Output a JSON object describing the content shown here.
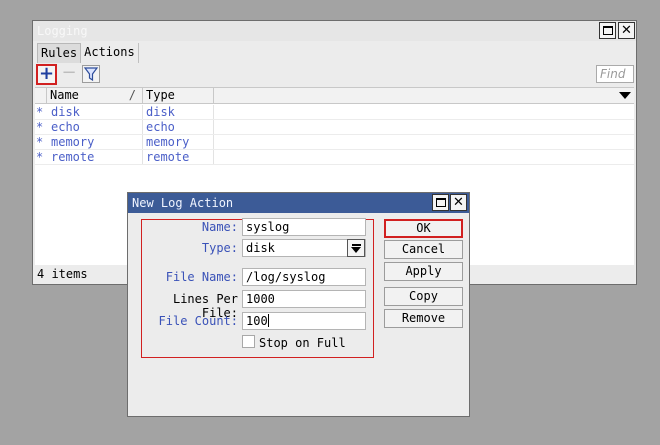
{
  "logging_window": {
    "title": "Logging",
    "tabs": [
      "Rules",
      "Actions"
    ],
    "find_placeholder": "Find",
    "columns": {
      "name": "Name",
      "type": "Type",
      "sort_mark": "/"
    },
    "rows": [
      {
        "marker": "*",
        "name": "disk",
        "type": "disk"
      },
      {
        "marker": "*",
        "name": "echo",
        "type": "echo"
      },
      {
        "marker": "*",
        "name": "memory",
        "type": "memory"
      },
      {
        "marker": "*",
        "name": "remote",
        "type": "remote"
      }
    ],
    "status": "4 items"
  },
  "dialog": {
    "title": "New Log Action",
    "fields": {
      "name_label": "Name:",
      "name_value": "syslog",
      "type_label": "Type:",
      "type_value": "disk",
      "file_name_label": "File Name:",
      "file_name_value": "/log/syslog",
      "lines_per_file_label": "Lines Per File:",
      "lines_per_file_value": "1000",
      "file_count_label": "File Count:",
      "file_count_value": "100",
      "stop_on_full_label": "Stop on Full"
    },
    "buttons": {
      "ok": "OK",
      "cancel": "Cancel",
      "apply": "Apply",
      "copy": "Copy",
      "remove": "Remove"
    }
  },
  "icons": {
    "add": "plus-icon",
    "remove": "minus-icon",
    "filter": "filter-icon",
    "maximize": "maximize-icon",
    "close": "close-icon",
    "dropdown": "chevron-down-icon"
  },
  "colors": {
    "accent_blue": "#3c5b97",
    "highlight_red": "#d12020",
    "list_text": "#4b5fc8"
  }
}
